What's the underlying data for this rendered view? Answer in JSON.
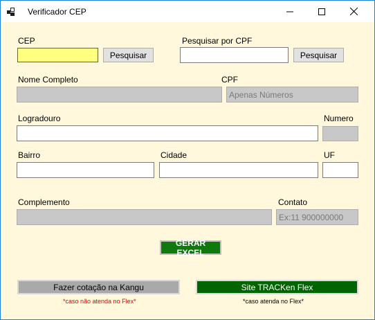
{
  "window": {
    "title": "Verificador CEP",
    "controls": {
      "minimize": "minimize-icon",
      "maximize": "maximize-icon",
      "close": "close-icon"
    }
  },
  "cep": {
    "label": "CEP",
    "value": "",
    "search_label": "Pesquisar"
  },
  "cpf_search": {
    "label": "Pesquisar por CPF",
    "value": "",
    "search_label": "Pesquisar"
  },
  "nome": {
    "label": "Nome Completo",
    "value": ""
  },
  "cpf": {
    "label": "CPF",
    "placeholder": "Apenas Números"
  },
  "logradouro": {
    "label": "Logradouro",
    "value": ""
  },
  "numero": {
    "label": "Numero",
    "value": ""
  },
  "bairro": {
    "label": "Bairro",
    "value": ""
  },
  "cidade": {
    "label": "Cidade",
    "value": ""
  },
  "uf": {
    "label": "UF",
    "value": ""
  },
  "complemento": {
    "label": "Complemento",
    "value": ""
  },
  "contato": {
    "label": "Contato",
    "placeholder": "Ex:11 900000000"
  },
  "actions": {
    "excel_label": "GERAR EXCEL",
    "kangu_label": "Fazer cotação na Kangu",
    "kangu_note": "*caso não atenda no Flex*",
    "tracken_label": "Site TRACKen Flex",
    "tracken_note": "*caso atenda no Flex*"
  },
  "colors": {
    "form_background": "#fff8dc",
    "focus_field": "#ffff80",
    "excel_button": "#0e7a0d",
    "tracken_button": "#006400",
    "kangu_button": "#a9a9a9",
    "kangu_note": "#e00000"
  }
}
